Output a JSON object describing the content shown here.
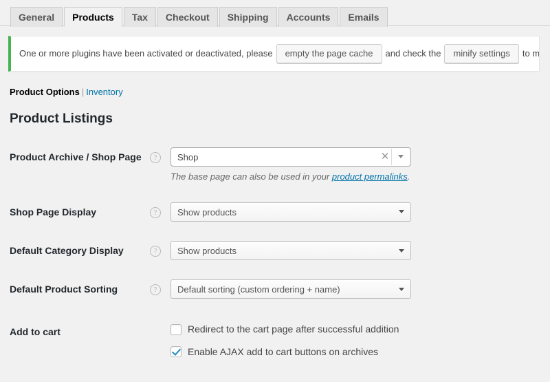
{
  "tabs": [
    {
      "label": "General",
      "active": false
    },
    {
      "label": "Products",
      "active": true
    },
    {
      "label": "Tax",
      "active": false
    },
    {
      "label": "Checkout",
      "active": false
    },
    {
      "label": "Shipping",
      "active": false
    },
    {
      "label": "Accounts",
      "active": false
    },
    {
      "label": "Emails",
      "active": false
    }
  ],
  "notice": {
    "text_before": "One or more plugins have been activated or deactivated, please",
    "button_1": "empty the page cache",
    "text_middle": "and check the",
    "button_2": "minify settings",
    "text_after": "to ma",
    "accent_color": "#46b450"
  },
  "subnav": {
    "current": "Product Options",
    "separator": "|",
    "link": "Inventory"
  },
  "section": {
    "title": "Product Listings"
  },
  "rows": {
    "archive": {
      "label": "Product Archive / Shop Page",
      "help_icon": "question-mark-circle-icon",
      "value": "Shop",
      "clear_icon": "clear-x-icon",
      "arrow_icon": "chevron-down-icon",
      "description_before": "The base page can also be used in your ",
      "description_link": "product permalinks",
      "description_after": "."
    },
    "shop_display": {
      "label": "Shop Page Display",
      "help_icon": "question-mark-circle-icon",
      "value": "Show products",
      "arrow_icon": "chevron-down-icon"
    },
    "category_display": {
      "label": "Default Category Display",
      "help_icon": "question-mark-circle-icon",
      "value": "Show products",
      "arrow_icon": "chevron-down-icon"
    },
    "sorting": {
      "label": "Default Product Sorting",
      "help_icon": "question-mark-circle-icon",
      "value": "Default sorting (custom ordering + name)",
      "arrow_icon": "chevron-down-icon"
    },
    "add_to_cart": {
      "label": "Add to cart",
      "checkbox_1": {
        "label": "Redirect to the cart page after successful addition",
        "checked": false
      },
      "checkbox_2": {
        "label": "Enable AJAX add to cart buttons on archives",
        "checked": true
      }
    }
  },
  "colors": {
    "page_background": "#f1f1f1",
    "link": "#0073aa",
    "notice_green": "#46b450",
    "checkbox_check": "#1e8cbe"
  }
}
